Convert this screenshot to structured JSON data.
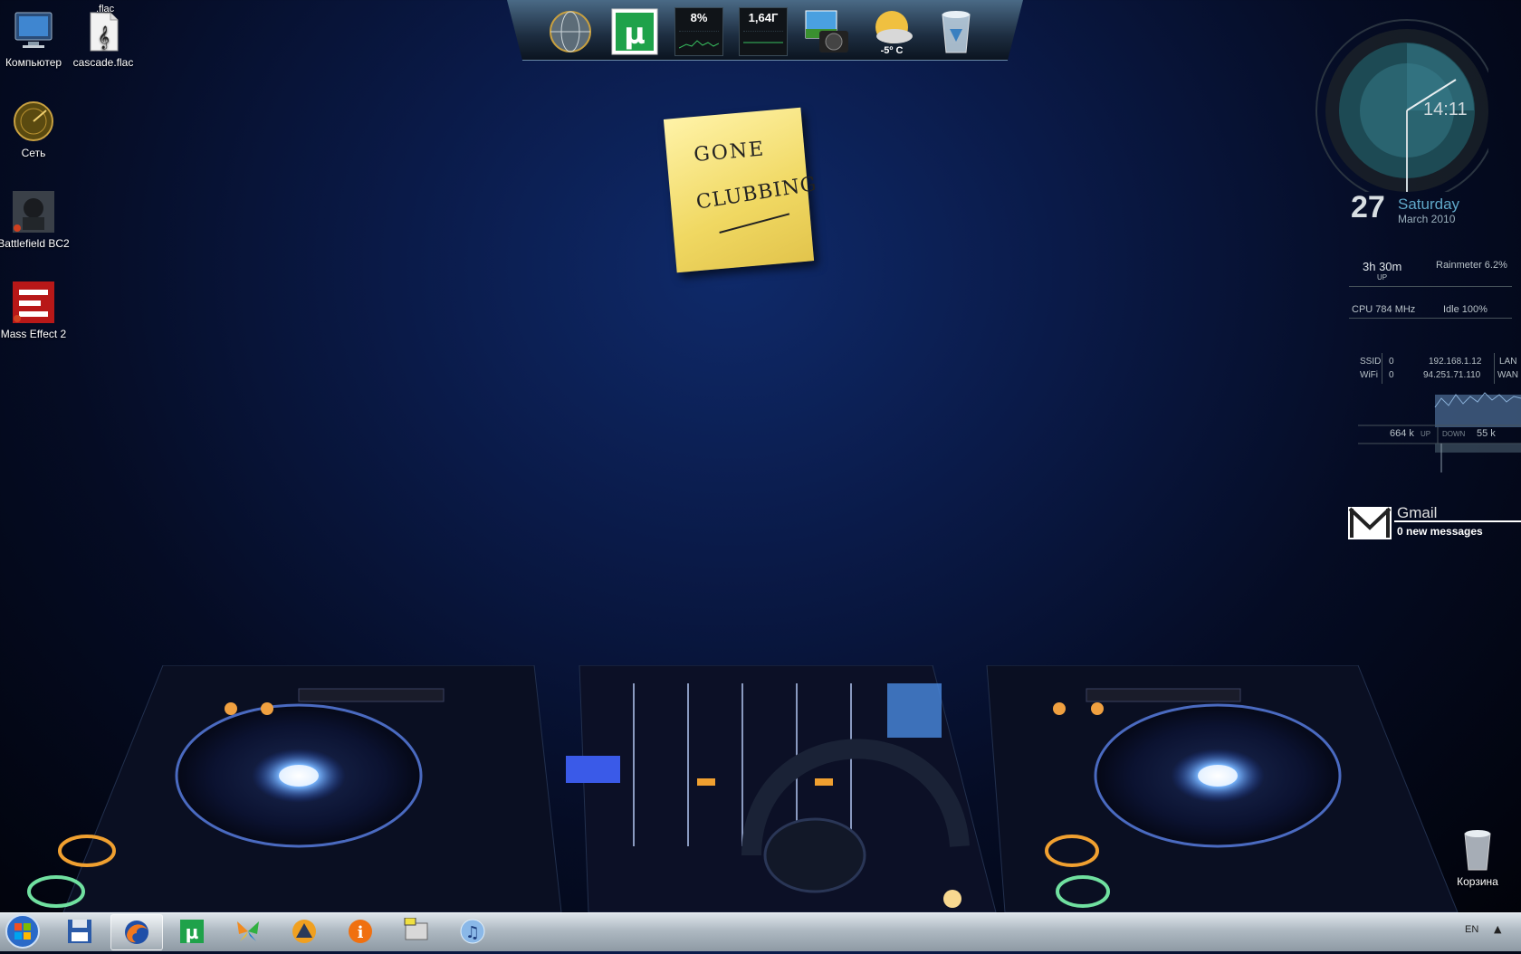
{
  "desktop_icons": [
    {
      "label": "Компьютер"
    },
    {
      "label": "cascade.flac",
      "badge": ".flac"
    },
    {
      "label": "Сеть"
    },
    {
      "label": "Battlefield BC2"
    },
    {
      "label": "Mass Effect 2"
    }
  ],
  "recycle_bin": {
    "label": "Корзина"
  },
  "dock": {
    "cpu_meter": "8%",
    "mem_meter": "1,64Г",
    "weather": "-5º C"
  },
  "sticky_note": {
    "line1": "GONE",
    "line2": "CLUBBING"
  },
  "clock": {
    "time": "14:11",
    "day": "27",
    "weekday": "Saturday",
    "month_year": "March 2010"
  },
  "rainmeter": {
    "uptime": "3h 30m",
    "uptime_label": "UP",
    "rainmeter_usage": "Rainmeter 6.2%",
    "cpu_freq": "CPU 784 MHz",
    "idle": "Idle 100%",
    "ssid_label": "SSID",
    "ssid_value": "0",
    "wifi_label": "WiFi",
    "wifi_value": "0",
    "lan_ip": "192.168.1.12",
    "lan_label": "LAN",
    "wan_ip": "94.251.71.110",
    "wan_label": "WAN",
    "up_value": "664 k",
    "up_label": "UP",
    "down_label": "DOWN",
    "down_value": "55 k"
  },
  "gmail": {
    "title": "Gmail",
    "messages": "0 new messages"
  },
  "taskbar": {
    "language": "EN",
    "tray_arrow": "▲"
  },
  "colors": {
    "accent": "#5fa8c8",
    "background": "#0a1a48"
  }
}
